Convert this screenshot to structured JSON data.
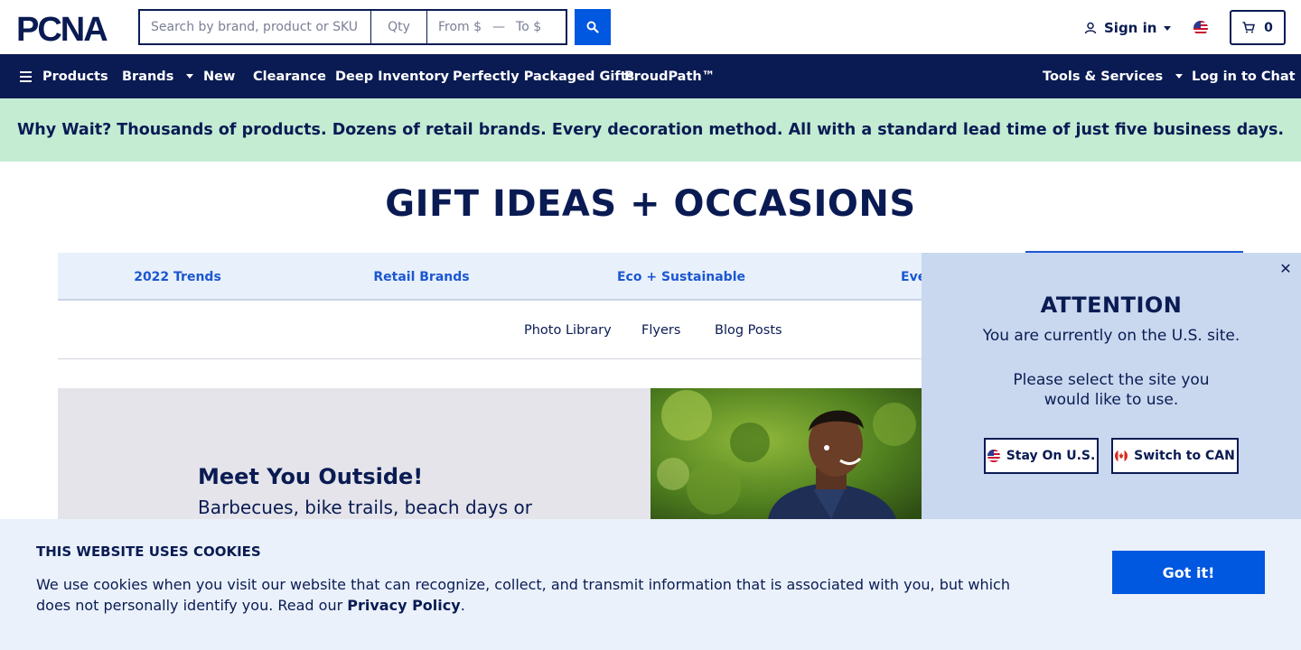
{
  "header": {
    "logo_text": "PCNA",
    "search_placeholder": "Search by brand, product or SKU",
    "qty_placeholder": "Qty",
    "price_from_placeholder": "From $",
    "price_to_placeholder": "To $",
    "sign_in": "Sign in",
    "cart_count": "0"
  },
  "nav": {
    "products": "Products",
    "brands": "Brands",
    "new": "New",
    "clearance": "Clearance",
    "deep_inventory": "Deep Inventory",
    "gifts": "Perfectly Packaged Gifts",
    "proudpath": "ProudPath™",
    "tools": "Tools & Services",
    "chat": "Log in to Chat"
  },
  "promo": {
    "text": "Why Wait? Thousands of products. Dozens of retail brands. Every decoration method. All with a standard lead time of just five business days."
  },
  "page": {
    "title": "GIFT IDEAS + OCCASIONS"
  },
  "tabs": [
    {
      "label": "2022 Trends"
    },
    {
      "label": "Retail Brands"
    },
    {
      "label": "Eco + Sustainable"
    },
    {
      "label": "Eve"
    }
  ],
  "subnav": [
    {
      "label": "Photo Library"
    },
    {
      "label": "Flyers"
    },
    {
      "label": "Blog Posts"
    }
  ],
  "hero": {
    "title": "Meet You Outside!",
    "text": "Barbecues, bike trails, beach days or"
  },
  "popup": {
    "close": "✕",
    "heading": "ATTENTION",
    "line1": "You are currently on the U.S. site.",
    "line2": "Please select the site you",
    "line3": "would like to use.",
    "stay_label": "Stay On U.S.",
    "switch_label": "Switch to CAN"
  },
  "cookie": {
    "title": "THIS WEBSITE USES COOKIES",
    "text_before": "We use cookies when you visit our website that can recognize, collect, and transmit information that is associated with you, but which does not personally identify you. Read our ",
    "policy_link": "Privacy Policy",
    "text_after": ".",
    "button": "Got it!"
  },
  "colors": {
    "navy": "#0a1b53",
    "blue": "#0057e0",
    "promo_bg": "#c3ecd3",
    "popup_bg": "#c9d8ef",
    "cookie_bg": "#eaf1fa"
  }
}
